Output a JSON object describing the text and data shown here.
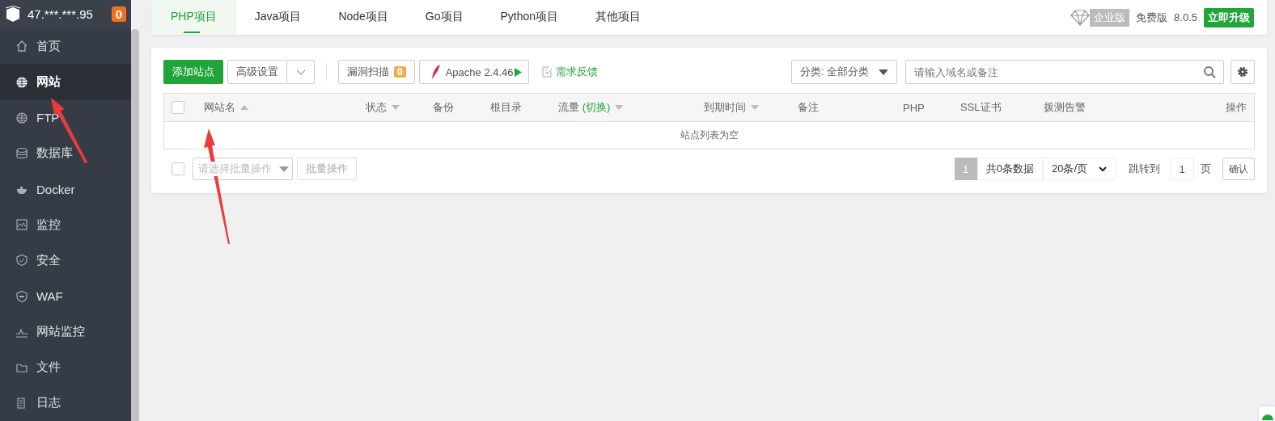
{
  "server": {
    "address": "47.***.***.95",
    "badge": "0"
  },
  "nav": [
    {
      "label": "首页",
      "selected": false
    },
    {
      "label": "网站",
      "selected": true
    },
    {
      "label": "FTP",
      "selected": false
    },
    {
      "label": "数据库",
      "selected": false
    },
    {
      "label": "Docker",
      "selected": false
    },
    {
      "label": "监控",
      "selected": false
    },
    {
      "label": "安全",
      "selected": false
    },
    {
      "label": "WAF",
      "selected": false
    },
    {
      "label": "网站监控",
      "selected": false
    },
    {
      "label": "文件",
      "selected": false
    },
    {
      "label": "日志",
      "selected": false
    }
  ],
  "tabs": [
    {
      "label": "PHP项目",
      "selected": true
    },
    {
      "label": "Java项目",
      "selected": false
    },
    {
      "label": "Node项目",
      "selected": false
    },
    {
      "label": "Go项目",
      "selected": false
    },
    {
      "label": "Python项目",
      "selected": false
    },
    {
      "label": "其他项目",
      "selected": false
    }
  ],
  "header_right": {
    "edition": "企业版",
    "plan": "免费版",
    "version": "8.0.5",
    "upgrade": "立即升级"
  },
  "toolbar": {
    "add_site": "添加站点",
    "advanced": "高级设置",
    "scan": "漏洞扫描",
    "scan_count": "0",
    "server": "Apache 2.4.46",
    "feedback": "需求反馈",
    "category": "分类: 全部分类",
    "search_placeholder": "请输入域名或备注"
  },
  "table": {
    "select_all_checked": false,
    "columns": [
      {
        "label": "网站名",
        "sortable": true,
        "ascending": true
      },
      {
        "label": "状态",
        "sortable": true,
        "ascending": false
      },
      {
        "label": "备份",
        "sortable": false
      },
      {
        "label": "根目录",
        "sortable": false
      },
      {
        "label": "流量",
        "link": "(切换)",
        "sortable": true,
        "ascending": false
      },
      {
        "label": "到期时间",
        "sortable": true,
        "ascending": false
      },
      {
        "label": "备注",
        "sortable": false
      },
      {
        "label": "PHP",
        "sortable": false
      },
      {
        "label": "SSL证书",
        "sortable": false
      },
      {
        "label": "拨测告警",
        "sortable": false
      },
      {
        "label": "操作",
        "sortable": false
      }
    ],
    "empty_message": "站点列表为空"
  },
  "footer": {
    "select_checked": false,
    "batch_placeholder": "请选择批量操作",
    "batch_button": "批量操作",
    "current_page": "1",
    "total": "共0条数据",
    "per_page": "20条/页",
    "jump_label": "跳转到",
    "jump_value": "1",
    "page_unit": "页",
    "confirm": "确认"
  }
}
